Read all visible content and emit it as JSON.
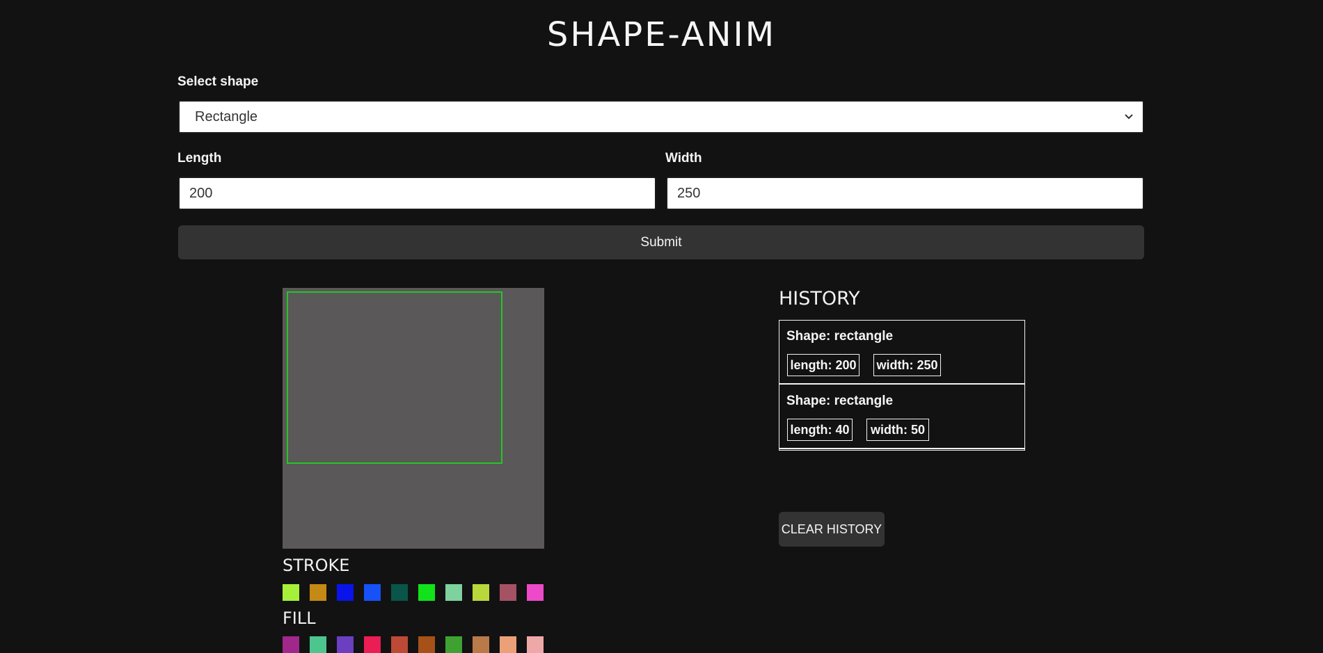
{
  "app": {
    "title": "SHAPE-ANIM"
  },
  "form": {
    "select_label": "Select shape",
    "selected_shape": "Rectangle",
    "length_label": "Length",
    "length_value": "200",
    "width_label": "Width",
    "width_value": "250",
    "submit_label": "Submit"
  },
  "canvas": {
    "background_color": "#5a5859",
    "shape_stroke_color": "#22c822"
  },
  "stroke": {
    "heading": "STROKE",
    "colors": [
      "#a6f03a",
      "#c58915",
      "#0a14ea",
      "#1652f8",
      "#0a5549",
      "#12e21a",
      "#7fd19d",
      "#bad83c",
      "#a55264",
      "#ec4ac8"
    ]
  },
  "fill": {
    "heading": "FILL",
    "colors": [
      "#a0288a",
      "#4dc68e",
      "#6b3fc0",
      "#ea1e54",
      "#bc4a36",
      "#a65118",
      "#3ea132",
      "#b97a4a",
      "#eca077",
      "#efa8a8"
    ]
  },
  "history": {
    "title": "HISTORY",
    "entries": [
      {
        "shape": "Shape: rectangle",
        "length": "length: 200",
        "width": "width: 250"
      },
      {
        "shape": "Shape: rectangle",
        "length": "length: 40",
        "width": "width: 50"
      }
    ],
    "clear_label": "CLEAR HISTORY"
  }
}
